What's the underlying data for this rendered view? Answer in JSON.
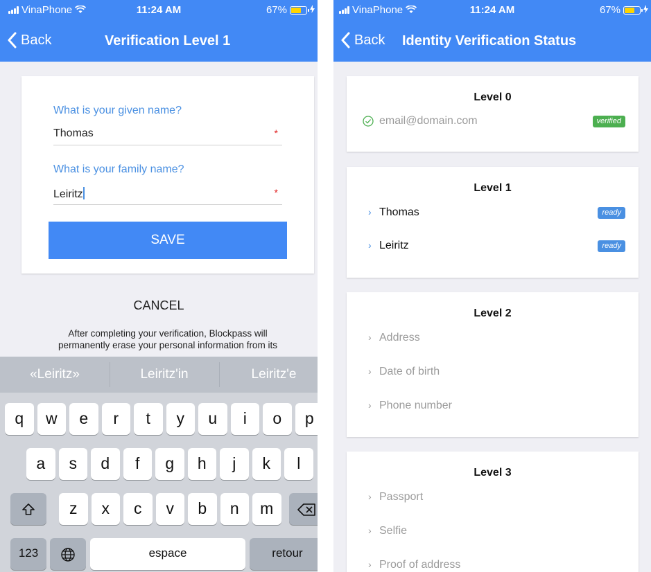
{
  "left": {
    "status": {
      "carrier": "VinaPhone",
      "time": "11:24 AM",
      "battery": "67%"
    },
    "nav": {
      "back": "Back",
      "title": "Verification Level 1"
    },
    "form": {
      "given_label": "What is your given name?",
      "given_value": "Thomas",
      "family_label": "What is your family name?",
      "family_value": "Leiritz",
      "required_mark": "*",
      "save": "SAVE"
    },
    "cancel": "CANCEL",
    "disclaimer": "After completing your verification, Blockpass will permanently erase your personal information from its",
    "keyboard": {
      "suggestions": [
        "«Leiritz»",
        "Leiritz'in",
        "Leiritz'e"
      ],
      "row1": [
        "q",
        "w",
        "e",
        "r",
        "t",
        "y",
        "u",
        "i",
        "o",
        "p"
      ],
      "row2": [
        "a",
        "s",
        "d",
        "f",
        "g",
        "h",
        "j",
        "k",
        "l"
      ],
      "row3": [
        "z",
        "x",
        "c",
        "v",
        "b",
        "n",
        "m"
      ],
      "numbers": "123",
      "space": "espace",
      "return": "retour"
    }
  },
  "right": {
    "status": {
      "carrier": "VinaPhone",
      "time": "11:24 AM",
      "battery": "67%"
    },
    "nav": {
      "back": "Back",
      "title": "Identity Verification Status"
    },
    "levels": [
      {
        "title": "Level 0",
        "items": [
          {
            "label": "email@domain.com",
            "badge": "verified"
          }
        ]
      },
      {
        "title": "Level 1",
        "items": [
          {
            "label": "Thomas",
            "badge": "ready"
          },
          {
            "label": "Leiritz",
            "badge": "ready"
          }
        ]
      },
      {
        "title": "Level 2",
        "items": [
          {
            "label": "Address"
          },
          {
            "label": "Date of birth"
          },
          {
            "label": "Phone number"
          }
        ]
      },
      {
        "title": "Level 3",
        "items": [
          {
            "label": "Passport"
          },
          {
            "label": "Selfie"
          },
          {
            "label": "Proof of address"
          }
        ]
      }
    ]
  },
  "icons": {
    "chevron": "›",
    "wifi": "ᯤ",
    "bolt": "⚡",
    "globe": "globe-icon",
    "shift": "shift-icon",
    "delete": "backspace-icon",
    "check": "check-circle-icon"
  },
  "colors": {
    "primary": "#4289f5",
    "label_blue": "#4a90e2",
    "verified_green": "#4caf50",
    "required_red": "#e02020"
  }
}
